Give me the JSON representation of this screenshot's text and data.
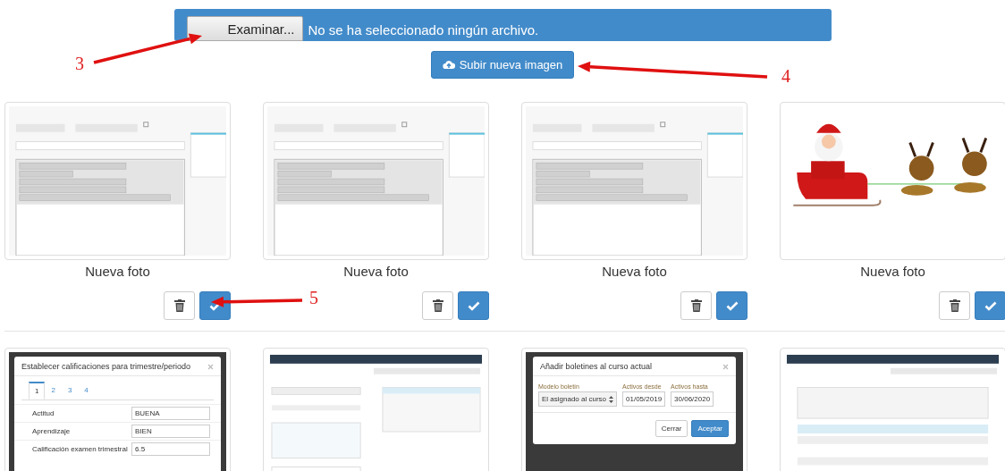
{
  "upload": {
    "browse_button": "Examinar...",
    "file_status": "No se ha seleccionado ningún archivo.",
    "upload_button": "Subir nueva imagen"
  },
  "photos": [
    {
      "kind": "editor",
      "caption": "Nueva foto",
      "delete_enabled": true
    },
    {
      "kind": "editor",
      "caption": "Nueva foto",
      "delete_enabled": true
    },
    {
      "kind": "editor",
      "caption": "Nueva foto",
      "delete_enabled": true
    },
    {
      "kind": "christmas",
      "caption": "Nueva foto",
      "delete_enabled": true
    },
    {
      "kind": "grades_dialog",
      "title": "Establecer calificaciones para trimestre/periodo",
      "tabs": [
        {
          "label": "1",
          "selected": true
        },
        {
          "label": "2",
          "selected": false
        },
        {
          "label": "3",
          "selected": false
        },
        {
          "label": "4",
          "selected": false
        }
      ],
      "rows": [
        {
          "label": "Actitud",
          "value": "BUENA"
        },
        {
          "label": "Aprendizaje",
          "value": "BIEN"
        },
        {
          "label": "Calificación examen trimestral",
          "value": "6.5"
        }
      ]
    },
    {
      "kind": "app_form"
    },
    {
      "kind": "bulletin_dialog",
      "title": "Añadir boletines al curso actual",
      "fields": [
        {
          "label": "Modelo boletín",
          "value": "El asignado al curso",
          "kind": "select"
        },
        {
          "label": "Activos desde",
          "value": "01/05/2019",
          "kind": "input"
        },
        {
          "label": "Activos hasta",
          "value": "30/06/2020",
          "kind": "input"
        }
      ],
      "buttons": [
        {
          "label": "Cerrar",
          "primary": false
        },
        {
          "label": "Aceptar",
          "primary": true
        }
      ]
    },
    {
      "kind": "app_table"
    }
  ],
  "annotations": [
    {
      "label": "3"
    },
    {
      "label": "4"
    },
    {
      "label": "5"
    }
  ]
}
